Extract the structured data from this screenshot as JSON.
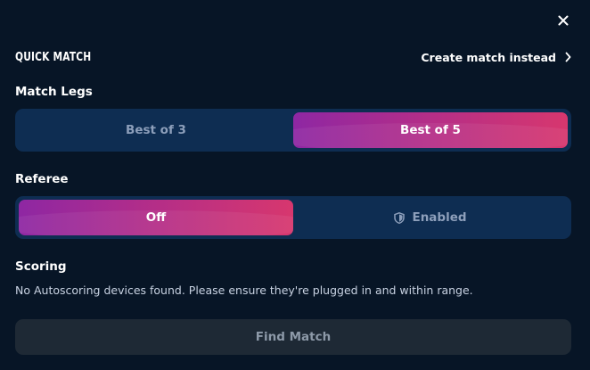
{
  "header": {
    "title": "QUICK MATCH",
    "create_link": "Create match instead"
  },
  "match_legs": {
    "label": "Match Legs",
    "options": [
      "Best of 3",
      "Best of 5"
    ],
    "selected": "Best of 5"
  },
  "referee": {
    "label": "Referee",
    "options": [
      "Off",
      "Enabled"
    ],
    "selected": "Off"
  },
  "scoring": {
    "label": "Scoring",
    "message": "No Autoscoring devices found. Please ensure they're plugged in and within range."
  },
  "find_match_label": "Find Match",
  "icons": {
    "close": "close-icon",
    "chevron": "chevron-right-icon",
    "shield": "shield-icon"
  },
  "colors": {
    "background": "#071526",
    "toggle_bg": "#0e2d52",
    "accent_start": "#8e27a3",
    "accent_end": "#d7376e",
    "disabled_button": "#1e2935"
  }
}
